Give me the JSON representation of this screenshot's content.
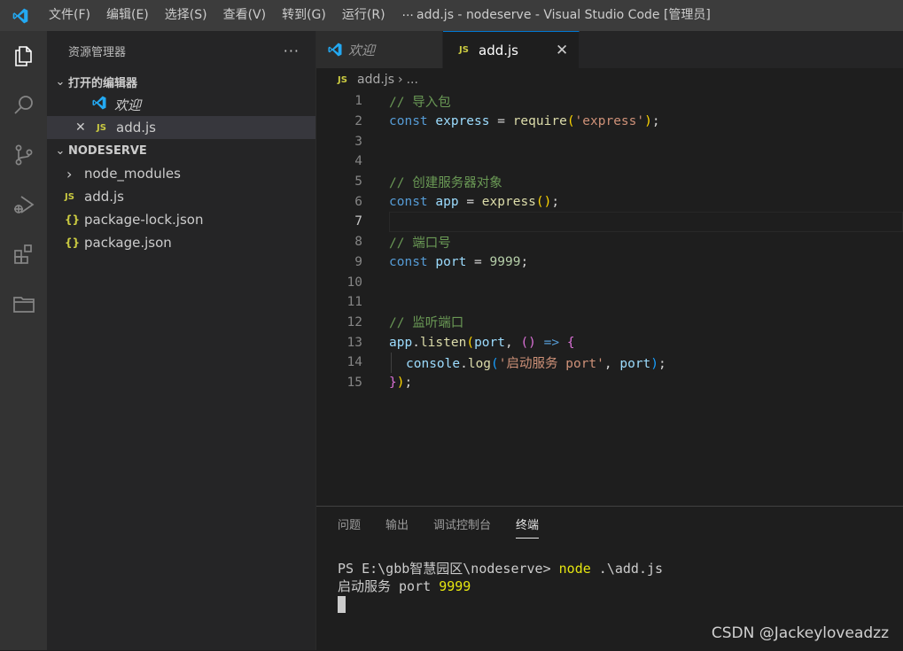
{
  "window": {
    "title": "add.js - nodeserve - Visual Studio Code [管理员]"
  },
  "menu": [
    "文件(F)",
    "编辑(E)",
    "选择(S)",
    "查看(V)",
    "转到(G)",
    "运行(R)"
  ],
  "menu_more": "···",
  "activity_icons": [
    "explorer-icon",
    "search-icon",
    "source-control-icon",
    "run-debug-icon",
    "extensions-icon",
    "remote-explorer-icon"
  ],
  "sidebar": {
    "title": "资源管理器",
    "more": "···",
    "open_editors": {
      "header": "打开的编辑器",
      "items": [
        {
          "label": "欢迎",
          "icon": "vscode-icon"
        },
        {
          "label": "add.js",
          "icon": "js-icon",
          "close": "✕"
        }
      ]
    },
    "folder": {
      "header": "NODESERVE",
      "items": [
        {
          "label": "node_modules",
          "type": "folder",
          "glyph": "›"
        },
        {
          "label": "add.js",
          "type": "js",
          "glyph": "JS"
        },
        {
          "label": "package-lock.json",
          "type": "json",
          "glyph": "{}"
        },
        {
          "label": "package.json",
          "type": "json",
          "glyph": "{}"
        }
      ]
    }
  },
  "tabs": [
    {
      "label": "欢迎",
      "active": false
    },
    {
      "label": "add.js",
      "active": true,
      "badge": "JS",
      "close": "✕"
    }
  ],
  "breadcrumb": {
    "badge": "JS",
    "file": "add.js",
    "sep": "›",
    "rest": "..."
  },
  "code": {
    "line_numbers": [
      "1",
      "2",
      "3",
      "4",
      "5",
      "6",
      "7",
      "8",
      "9",
      "10",
      "11",
      "12",
      "13",
      "14",
      "15"
    ],
    "current_line": 7,
    "l1": "// 导入包",
    "l2": {
      "kw": "const",
      "name": "express",
      "eq": " = ",
      "fn": "require",
      "p1": "(",
      "str": "'express'",
      "p2": ")",
      "end": ";"
    },
    "l5": "// 创建服务器对象",
    "l6": {
      "kw": "const",
      "name": "app",
      "eq": " = ",
      "fn": "express",
      "parens": "()",
      "end": ";"
    },
    "l8": "// 端口号",
    "l9": {
      "kw": "const",
      "name": "port",
      "eq": " = ",
      "num": "9999",
      "end": ";"
    },
    "l12": "// 监听端口",
    "l13": {
      "obj": "app",
      "dot": ".",
      "fn": "listen",
      "p1": "(",
      "arg": "port",
      "comma": ", ",
      "p2": "()",
      "arrow": " => ",
      "brace": "{"
    },
    "l14": {
      "obj": "console",
      "dot": ".",
      "fn": "log",
      "p1": "(",
      "str": "'启动服务 port'",
      "comma": ", ",
      "arg": "port",
      "p2": ")",
      "end": ";"
    },
    "l15": {
      "brace": "}",
      "paren": ")",
      "end": ";"
    }
  },
  "panel": {
    "tabs": [
      "问题",
      "输出",
      "调试控制台",
      "终端"
    ],
    "active_tab": "终端",
    "terminal": {
      "prompt": "PS E:\\gbb智慧园区\\nodeserve> ",
      "cmd": "node",
      "args": " .\\add.js",
      "output_text": "启动服务 port ",
      "output_num": "9999"
    }
  },
  "watermark": "CSDN @Jackeyloveadzz",
  "colors": {
    "accent": "#0078d4",
    "vscode_blue": "#23a9f2",
    "js_yellow": "#cbcb41"
  }
}
